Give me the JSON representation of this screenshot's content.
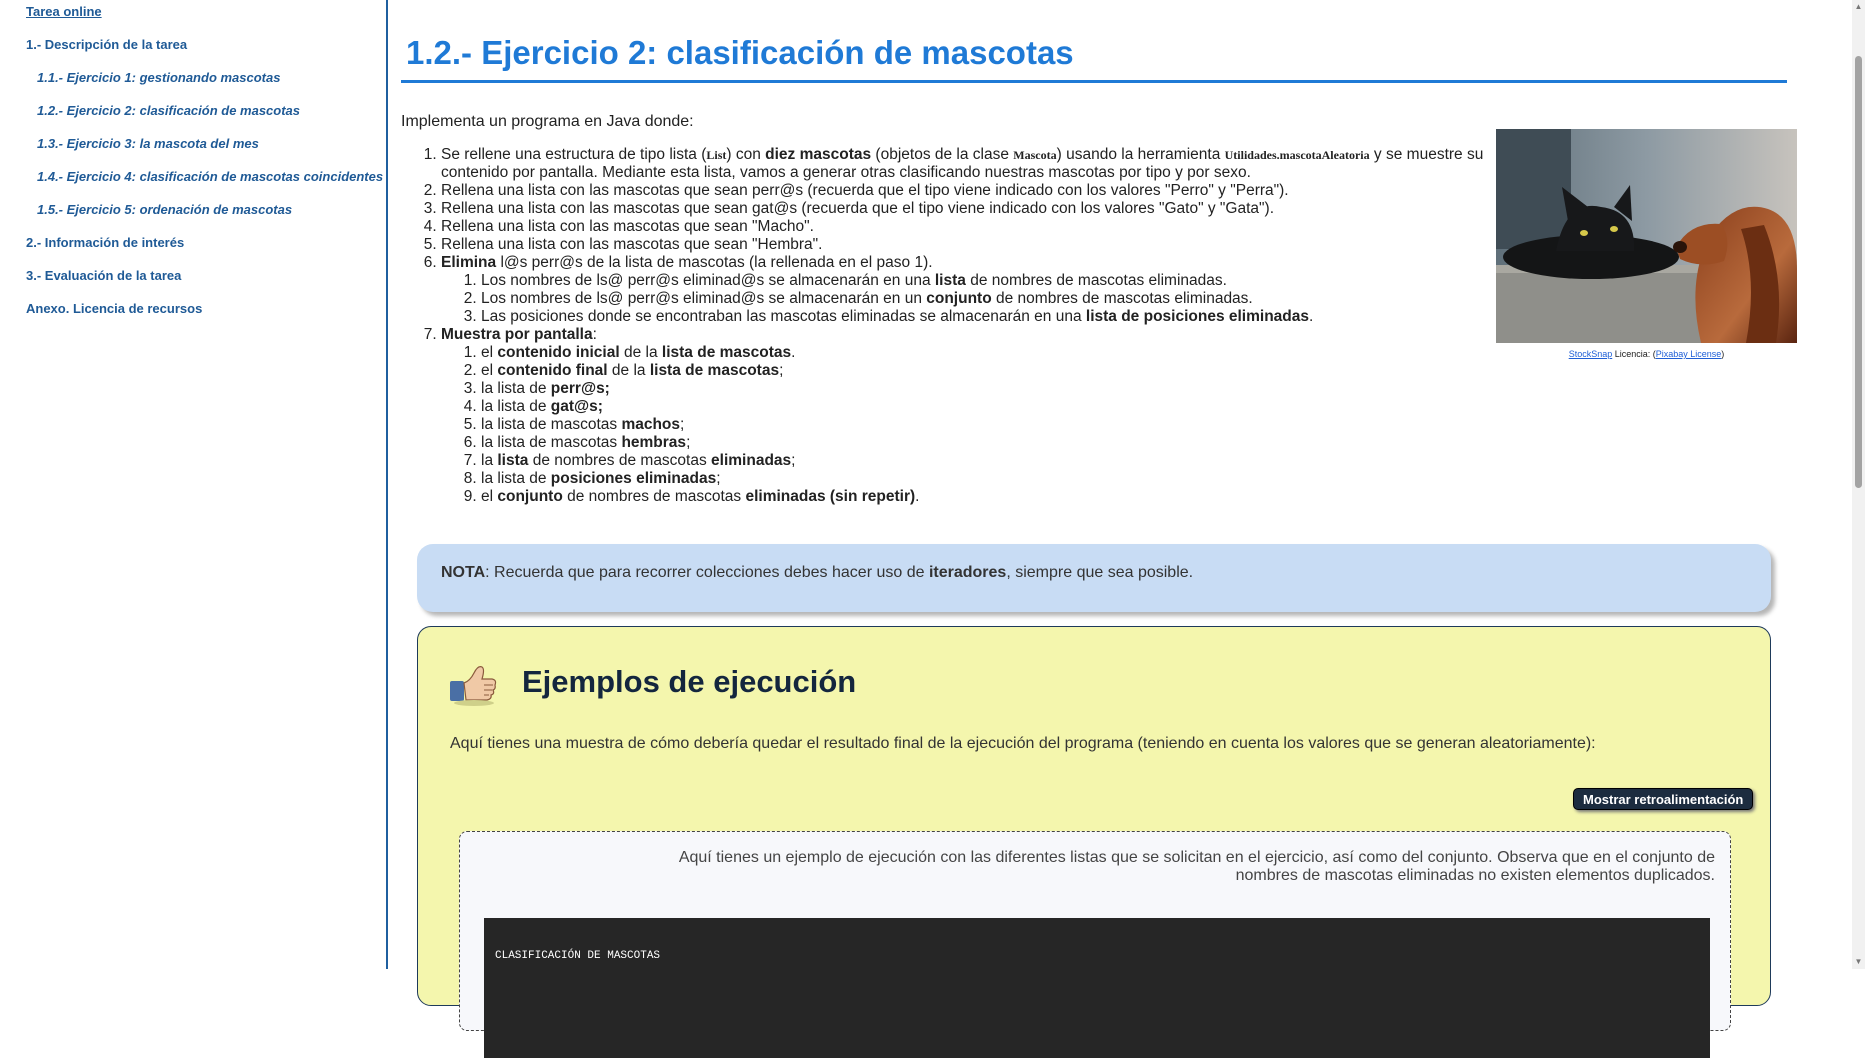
{
  "sidebar": {
    "top_link": "Tarea online",
    "items": [
      {
        "label": "1.- Descripción de la tarea",
        "level": 1
      },
      {
        "label": "1.1.- Ejercicio 1: gestionando mascotas",
        "level": 2
      },
      {
        "label": "1.2.- Ejercicio 2: clasificación de mascotas",
        "level": 2
      },
      {
        "label": "1.3.- Ejercicio 3: la mascota del mes",
        "level": 2
      },
      {
        "label": "1.4.- Ejercicio 4: clasificación de mascotas coincidentes",
        "level": 2
      },
      {
        "label": "1.5.- Ejercicio 5: ordenación de mascotas",
        "level": 2
      },
      {
        "label": "2.- Información de interés",
        "level": 1
      },
      {
        "label": "3.- Evaluación de la tarea",
        "level": 1
      },
      {
        "label": "Anexo. Licencia de recursos",
        "level": 1
      }
    ]
  },
  "main": {
    "title": "1.2.- Ejercicio 2: clasificación de mascotas",
    "intro": "Implementa un programa en Java donde:",
    "list": {
      "i1": {
        "a": "Se rellene una estructura de tipo lista (",
        "code1": "List",
        "b": ") con ",
        "bold1": "diez mascotas",
        "c": " (objetos de la clase ",
        "code2": "Mascota",
        "d": ") usando la herramienta ",
        "code3": "Utilidades.mascotaAleatoria",
        "e": " y se muestre su contenido por pantalla. Mediante esta lista, vamos a generar otras clasificando nuestras mascotas por tipo y por sexo."
      },
      "i2": "Rellena una lista con las mascotas que sean perr@s (recuerda que el tipo viene indicado con los valores \"Perro\" y \"Perra\").",
      "i3": "Rellena una lista con las mascotas que sean gat@s (recuerda que el tipo viene indicado con los valores \"Gato\" y \"Gata\").",
      "i4": "Rellena una lista con las mascotas que sean \"Macho\".",
      "i5": "Rellena una lista con las mascotas que sean \"Hembra\".",
      "i6": {
        "bold": "Elimina",
        "rest": " l@s perr@s de la lista de mascotas (la rellenada en el paso 1).",
        "sub1": {
          "a": "Los nombres de ls@ perr@s eliminad@s se almacenarán en una ",
          "bold": "lista",
          "b": " de nombres de mascotas eliminadas."
        },
        "sub2": {
          "a": "Los nombres de ls@ perr@s eliminad@s se almacenarán en un ",
          "bold": "conjunto",
          "b": " de nombres de mascotas eliminadas."
        },
        "sub3": {
          "a": "Las posiciones donde se encontraban las mascotas eliminadas se almacenarán en una ",
          "bold": "lista de posiciones eliminadas",
          "b": "."
        }
      },
      "i7": {
        "bold": "Muestra por pantalla",
        "rest": ":",
        "s1": {
          "a": "el ",
          "b1": "contenido inicial",
          "m": " de la ",
          "b2": "lista de mascotas",
          "e": "."
        },
        "s2": {
          "a": "el ",
          "b1": "contenido final",
          "m": " de la ",
          "b2": "lista de mascotas",
          "e": ";"
        },
        "s3": {
          "a": "la lista de ",
          "b": "perr@s;"
        },
        "s4": {
          "a": "la lista de ",
          "b": "gat@s;"
        },
        "s5": {
          "a": "la lista de mascotas ",
          "b": "machos",
          "e": ";"
        },
        "s6": {
          "a": "la lista de mascotas ",
          "b": "hembras",
          "e": ";"
        },
        "s7": {
          "a": "la ",
          "b1": "lista",
          "m": " de nombres de mascotas ",
          "b2": "eliminadas",
          "e": ";"
        },
        "s8": {
          "a": "la lista de ",
          "b": "posiciones eliminadas",
          "e": ";"
        },
        "s9": {
          "a": "el ",
          "b1": "conjunto",
          "m": " de nombres de mascotas ",
          "b2": "eliminadas (sin repetir)",
          "e": "."
        }
      }
    },
    "figure": {
      "caption_link1": "StockSnap",
      "caption_mid": " Licencia: (",
      "caption_link2": "Pixabay License",
      "caption_end": ")"
    },
    "note": {
      "label": "NOTA",
      "a": ": Recuerda que para recorrer colecciones debes hacer uso de ",
      "bold": "iteradores",
      "b": ", siempre que sea posible."
    },
    "examples": {
      "title": "Ejemplos de ejecución",
      "description": "Aquí tienes una muestra de cómo debería quedar el resultado final de la ejecución del programa (teniendo en cuenta los valores que se generan aleatoriamente):",
      "button": "Mostrar retroalimentación",
      "feedback_text": "Aquí tienes un ejemplo de ejecución con las diferentes listas que se solicitan en el ejercicio, así como del conjunto. Observa que en el conjunto de nombres de mascotas eliminadas no existen elementos duplicados.",
      "console_text": "CLASIFICACIÓN DE MASCOTAS"
    }
  },
  "colors": {
    "accent": "#1f7ad6",
    "sidebar_link": "#1f5a96",
    "note_bg": "#c8dcf4",
    "examples_bg": "#f4f6ad",
    "button_bg": "#1c2c3f",
    "console_bg": "#262626"
  }
}
